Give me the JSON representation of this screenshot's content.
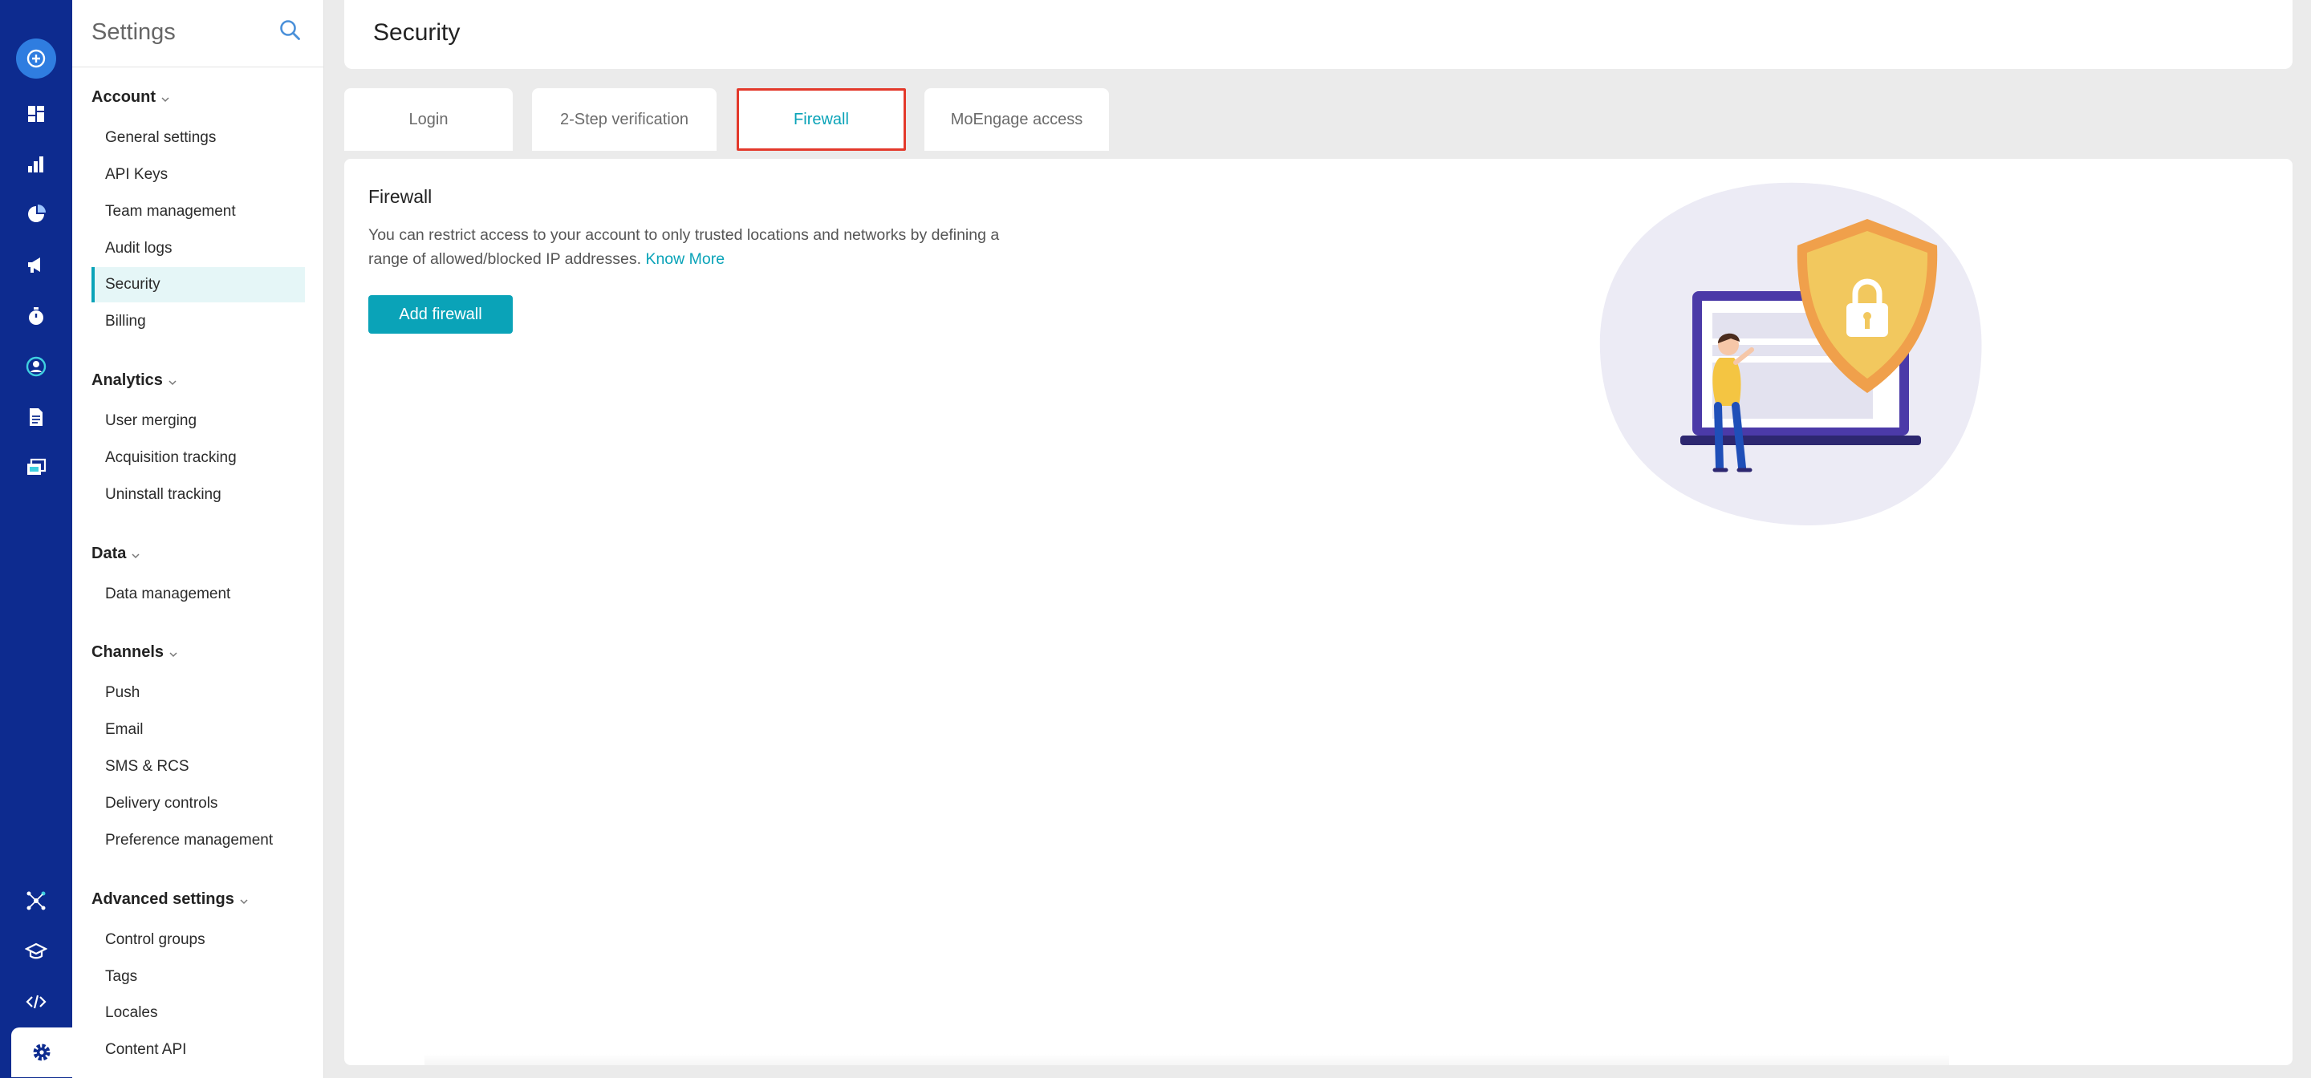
{
  "rail": {
    "icons": [
      "create-icon",
      "dashboard-icon",
      "analytics-icon",
      "pie-chart-icon",
      "megaphone-icon",
      "timer-icon",
      "user-segment-icon",
      "document-icon",
      "content-library-icon",
      "integrations-icon",
      "academy-icon",
      "code-icon",
      "settings-gear-icon"
    ]
  },
  "sidebar": {
    "title": "Settings",
    "groups": [
      {
        "label": "Account",
        "items": [
          "General settings",
          "API Keys",
          "Team management",
          "Audit logs",
          "Security",
          "Billing"
        ]
      },
      {
        "label": "Analytics",
        "items": [
          "User merging",
          "Acquisition tracking",
          "Uninstall tracking"
        ]
      },
      {
        "label": "Data",
        "items": [
          "Data management"
        ]
      },
      {
        "label": "Channels",
        "items": [
          "Push",
          "Email",
          "SMS & RCS",
          "Delivery controls",
          "Preference management"
        ]
      },
      {
        "label": "Advanced settings",
        "items": [
          "Control groups",
          "Tags",
          "Locales",
          "Content API"
        ]
      }
    ],
    "active_item": "Security"
  },
  "header": {
    "title": "Security"
  },
  "tabs": [
    {
      "label": "Login"
    },
    {
      "label": "2-Step verification"
    },
    {
      "label": "Firewall"
    },
    {
      "label": "MoEngage access"
    }
  ],
  "active_tab": "Firewall",
  "firewall": {
    "title": "Firewall",
    "description": "You can restrict access to your account to only trusted locations and networks by defining a range of allowed/blocked IP addresses.",
    "link": "Know More",
    "button": "Add firewall"
  },
  "colors": {
    "rail": "#0d2b8f",
    "accent": "#0aa3b8",
    "highlight_border": "#e3392b",
    "shield": "#f2c85e"
  }
}
